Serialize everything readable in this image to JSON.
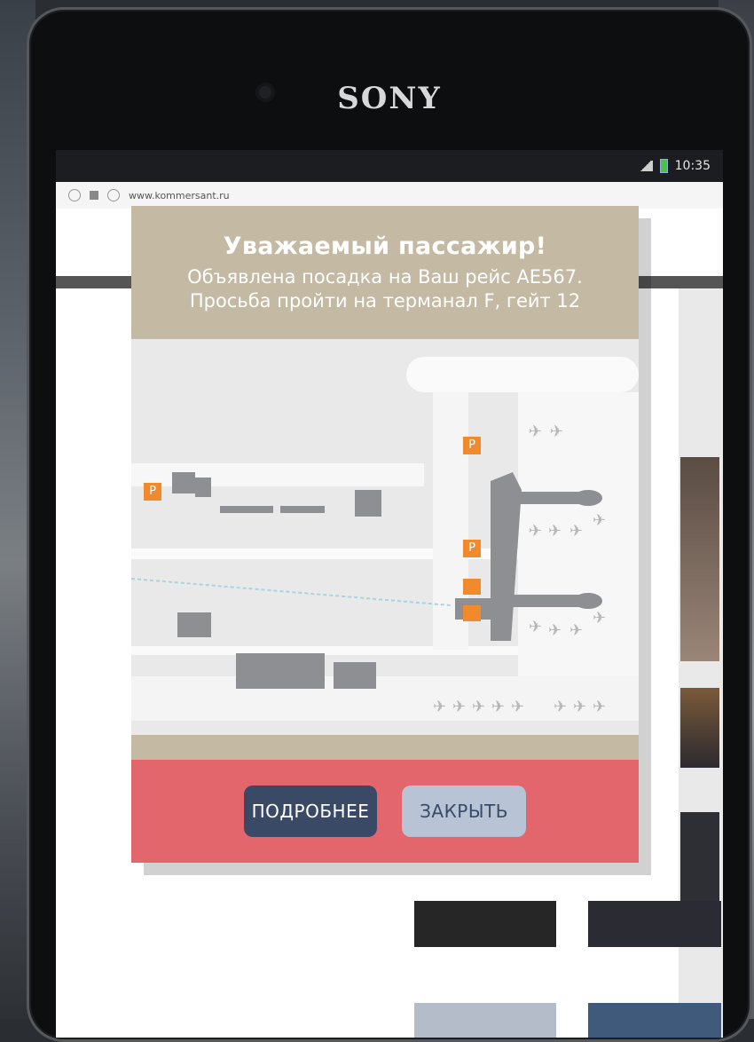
{
  "device": {
    "brand": "SONY"
  },
  "status_bar": {
    "time": "10:35"
  },
  "browser": {
    "url": "www.kommersant.ru"
  },
  "modal": {
    "title": "Уважаемый пассажир!",
    "line1": "Объявлена посадка на Ваш рейс AE567.",
    "line2": "Просьба пройти на терманал F, гейт 12",
    "parking_label": "P",
    "buttons": {
      "more": "ПОДРОБНЕЕ",
      "close": "ЗАКРЫТЬ"
    }
  },
  "colors": {
    "header_bg": "#c4b9a3",
    "footer_bg": "#e3666c",
    "btn_more": "#3a4a66",
    "btn_close": "#b8c4d6",
    "parking": "#f08a2c"
  }
}
